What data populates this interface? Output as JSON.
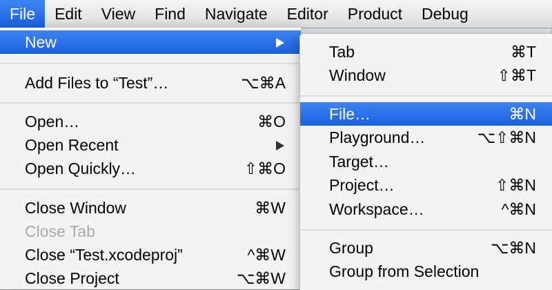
{
  "menubar": {
    "items": [
      "File",
      "Edit",
      "View",
      "Find",
      "Navigate",
      "Editor",
      "Product",
      "Debug"
    ]
  },
  "file_menu": {
    "new": {
      "label": "New"
    },
    "add_files": {
      "label": "Add Files to “Test”…",
      "shortcut": "⌥⌘A"
    },
    "open": {
      "label": "Open…",
      "shortcut": "⌘O"
    },
    "open_recent": {
      "label": "Open Recent"
    },
    "open_quickly": {
      "label": "Open Quickly…",
      "shortcut": "⇧⌘O"
    },
    "close_window": {
      "label": "Close Window",
      "shortcut": "⌘W"
    },
    "close_tab": {
      "label": "Close Tab"
    },
    "close_project_file": {
      "label": "Close “Test.xcodeproj”",
      "shortcut": "^⌘W"
    },
    "close_project": {
      "label": "Close Project",
      "shortcut": "⌥⌘W"
    }
  },
  "new_submenu": {
    "tab": {
      "label": "Tab",
      "shortcut": "⌘T"
    },
    "window": {
      "label": "Window",
      "shortcut": "⇧⌘T"
    },
    "file": {
      "label": "File…",
      "shortcut": "⌘N"
    },
    "playground": {
      "label": "Playground…",
      "shortcut": "⌥⇧⌘N"
    },
    "target": {
      "label": "Target…"
    },
    "project": {
      "label": "Project…",
      "shortcut": "⇧⌘N"
    },
    "workspace": {
      "label": "Workspace…",
      "shortcut": "^⌘N"
    },
    "group": {
      "label": "Group",
      "shortcut": "⌥⌘N"
    },
    "group_from_selection": {
      "label": "Group from Selection"
    }
  },
  "colors": {
    "highlight": "#2a6ff0",
    "menu_bg": "#f4f4f4",
    "disabled_text": "#a9a9a9"
  }
}
